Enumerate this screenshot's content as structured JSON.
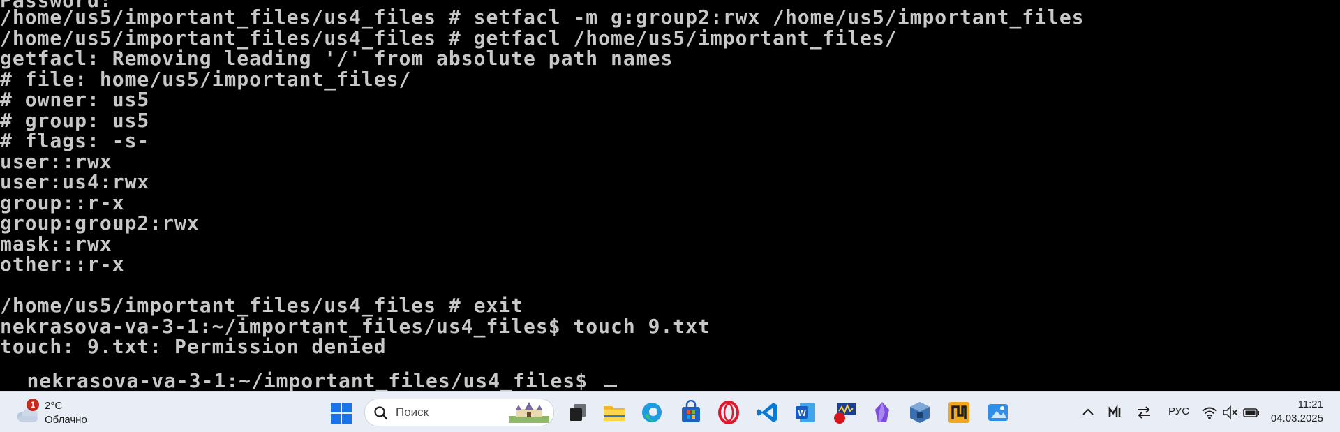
{
  "terminal": {
    "lines": [
      "Password:",
      "/home/us5/important_files/us4_files # setfacl -m g:group2:rwx /home/us5/important_files",
      "/home/us5/important_files/us4_files # getfacl /home/us5/important_files/",
      "getfacl: Removing leading '/' from absolute path names",
      "# file: home/us5/important_files/",
      "# owner: us5",
      "# group: us5",
      "# flags: -s-",
      "user::rwx",
      "user:us4:rwx",
      "group::r-x",
      "group:group2:rwx",
      "mask::rwx",
      "other::r-x",
      "",
      "/home/us5/important_files/us4_files # exit",
      "nekrasova-va-3-1:~/important_files/us4_files$ touch 9.txt",
      "touch: 9.txt: Permission denied",
      "nekrasova-va-3-1:~/important_files/us4_files$ "
    ]
  },
  "taskbar": {
    "weather": {
      "badge": "1",
      "temp": "2°C",
      "condition": "Облачно",
      "icon": "cloud-icon"
    },
    "search": {
      "placeholder": "Поиск"
    },
    "apps": [
      "task-view",
      "file-explorer",
      "edge",
      "store",
      "opera",
      "vscode",
      "word",
      "scope-app",
      "obsidian",
      "virtualbox",
      "app-yellow",
      "paint-app"
    ],
    "tray": {
      "language": "РУС"
    },
    "clock": {
      "time": "11:21",
      "date": "04.03.2025"
    }
  }
}
